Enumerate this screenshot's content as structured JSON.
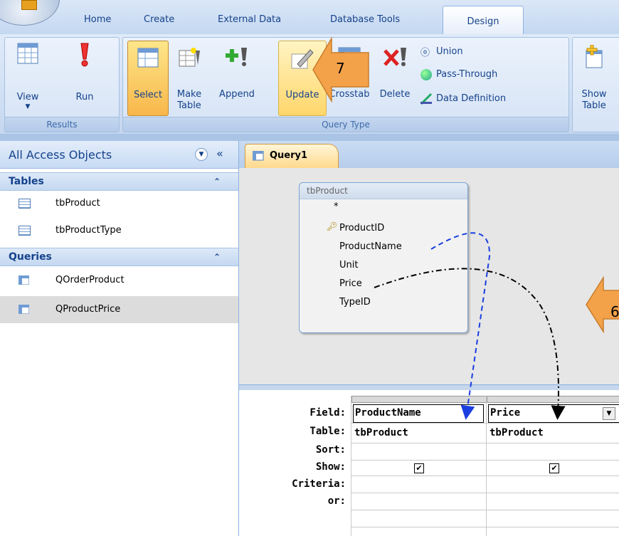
{
  "ribbon": {
    "tabs": [
      "Home",
      "Create",
      "External Data",
      "Database Tools",
      "Design"
    ],
    "results": {
      "view_label": "View",
      "run_label": "Run",
      "group_label": "Results"
    },
    "query_type": {
      "select_label": "Select",
      "make_table_label": "Make\nTable",
      "make_table_l1": "Make",
      "make_table_l2": "Table",
      "append_label": "Append",
      "update_label": "Update",
      "crosstab_label": "Crosstab",
      "delete_label": "Delete",
      "union_label": "Union",
      "passthrough_label": "Pass-Through",
      "datadef_label": "Data Definition",
      "group_label": "Query Type"
    },
    "show_table_l1": "Show",
    "show_table_l2": "Table",
    "callout_7": "7"
  },
  "nav": {
    "title": "All Access Objects",
    "tables_header": "Tables",
    "tables": [
      "tbProduct",
      "tbProductType"
    ],
    "queries_header": "Queries",
    "queries": [
      "QOrderProduct",
      "QProductPrice"
    ]
  },
  "doc": {
    "tab_label": "Query1",
    "table_name": "tbProduct",
    "fields": [
      "*",
      "ProductID",
      "ProductName",
      "Unit",
      "Price",
      "TypeID"
    ],
    "callout_6": "6",
    "grid": {
      "row_labels": [
        "Field:",
        "Table:",
        "Sort:",
        "Show:",
        "Criteria:",
        "or:"
      ],
      "columns": [
        {
          "field": "ProductName",
          "table": "tbProduct",
          "show": true
        },
        {
          "field": "Price",
          "table": "tbProduct",
          "show": true
        }
      ]
    }
  },
  "colors": {
    "accent": "#15428b",
    "callout": "#f4a24a",
    "arrow_blue": "#1a3ee0"
  }
}
